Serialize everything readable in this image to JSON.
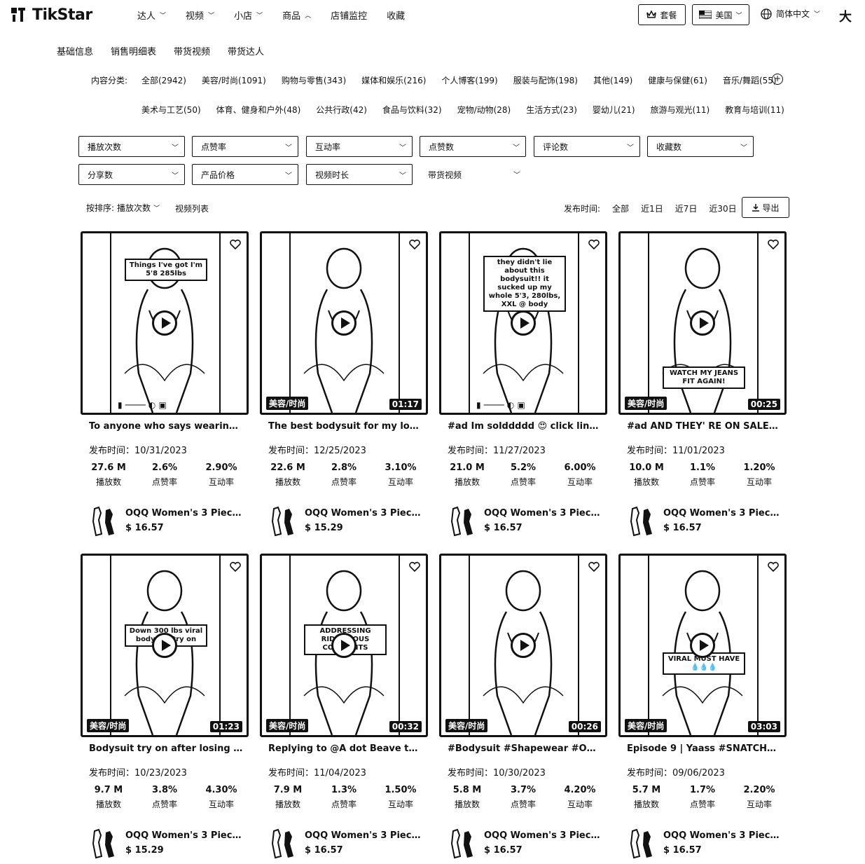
{
  "app": {
    "name": "TikStar"
  },
  "nav": {
    "items": [
      {
        "label": "达人",
        "chevron": "down"
      },
      {
        "label": "视频",
        "chevron": "down"
      },
      {
        "label": "小店",
        "chevron": "down"
      },
      {
        "label": "商品",
        "chevron": "up"
      },
      {
        "label": "店铺监控",
        "chevron": ""
      },
      {
        "label": "收藏",
        "chevron": ""
      }
    ],
    "plan_label": "套餐",
    "region_label": "美国",
    "lang_label": "简体中文",
    "big_label": "大"
  },
  "subtabs": [
    "基础信息",
    "销售明细表",
    "带货视频",
    "带货达人"
  ],
  "categories": {
    "label": "内容分类:",
    "row1": [
      "全部(2942)",
      "美容/时尚(1091)",
      "购物与零售(343)",
      "媒体和娱乐(216)",
      "个人博客(199)",
      "服装与配饰(198)",
      "其他(149)",
      "健康与保健(61)",
      "音乐/舞蹈(55)"
    ],
    "row2": [
      "美术与工艺(50)",
      "体育、健身和户外(48)",
      "公共行政(42)",
      "食品与饮料(32)",
      "宠物/动物(28)",
      "生活方式(23)",
      "婴幼儿(21)",
      "旅游与观光(11)",
      "教育与培训(11)"
    ]
  },
  "filters": {
    "row1": [
      "播放次数",
      "点赞率",
      "互动率",
      "点赞数",
      "评论数",
      "收藏数"
    ],
    "row2": [
      "分享数",
      "产品价格",
      "视频时长",
      "带货视频"
    ]
  },
  "sort": {
    "label": "按排序:",
    "value": "播放次数",
    "list_view": "视频列表"
  },
  "date_filter": {
    "label": "发布时间:",
    "options": [
      "全部",
      "近1日",
      "近7日",
      "近30日"
    ]
  },
  "export_label": "导出",
  "stat_labels": {
    "plays": "播放数",
    "like_rate": "点赞率",
    "engagement": "互动率",
    "date_prefix": "发布时间："
  },
  "videos": [
    {
      "title": "To anyone who says wearing ...",
      "date": "10/31/2023",
      "plays": "27.6 M",
      "like_rate": "2.6%",
      "engagement": "2.90%",
      "product": "OQQ Women's 3 Piece...",
      "price": "$ 16.57",
      "badge": "",
      "duration": "",
      "overlay": "Things I've got I'm 5'8 285lbs",
      "controls": true
    },
    {
      "title": "The best bodysuit for my loos...",
      "date": "12/25/2023",
      "plays": "22.6 M",
      "like_rate": "2.8%",
      "engagement": "3.10%",
      "product": "OQQ Women's 3 Piece...",
      "price": "$ 15.29",
      "badge": "美容/时尚",
      "duration": "01:17",
      "overlay": "",
      "controls": false
    },
    {
      "title": "#ad Im solddddd 😍 click link...",
      "date": "11/27/2023",
      "plays": "21.0 M",
      "like_rate": "5.2%",
      "engagement": "6.00%",
      "product": "OQQ Women's 3 Piece...",
      "price": "$ 16.57",
      "badge": "",
      "duration": "",
      "overlay": "they didn't lie about this bodysuit!! it sucked up my whole 5'3, 280lbs, XXL @ body",
      "controls": true
    },
    {
      "title": "#ad AND THEY' RE ON SALE ...",
      "date": "11/01/2023",
      "plays": "10.0 M",
      "like_rate": "1.1%",
      "engagement": "1.20%",
      "product": "OQQ Women's 3 Piece...",
      "price": "$ 16.57",
      "badge": "美容/时尚",
      "duration": "00:25",
      "overlay": "WATCH MY JEANS FIT AGAIN!",
      "controls": false
    },
    {
      "title": "Bodysuit try on after losing 3...",
      "date": "10/23/2023",
      "plays": "9.7 M",
      "like_rate": "3.8%",
      "engagement": "4.30%",
      "product": "OQQ Women's 3 Piece...",
      "price": "$ 15.29",
      "badge": "美容/时尚",
      "duration": "01:23",
      "overlay": "Down 300 lbs viral bodysuit try on",
      "controls": false
    },
    {
      "title": "Replying to @A dot Beave thi...",
      "date": "11/04/2023",
      "plays": "7.9 M",
      "like_rate": "1.3%",
      "engagement": "1.50%",
      "product": "OQQ Women's 3 Piece...",
      "price": "$ 16.57",
      "badge": "美容/时尚",
      "duration": "00:32",
      "overlay": "ADDRESSING RIDICULOUS COMMENTS",
      "controls": false
    },
    {
      "title": "#Bodysuit #Shapewear #OQQ...",
      "date": "10/30/2023",
      "plays": "5.8 M",
      "like_rate": "3.7%",
      "engagement": "4.20%",
      "product": "OQQ Women's 3 Piece...",
      "price": "$ 16.57",
      "badge": "美容/时尚",
      "duration": "00:26",
      "overlay": "",
      "controls": false
    },
    {
      "title": "Episode 9 | Yaass #SNATCHED...",
      "date": "09/06/2023",
      "plays": "5.7 M",
      "like_rate": "1.7%",
      "engagement": "2.20%",
      "product": "OQQ Women's 3 Piece...",
      "price": "$ 16.57",
      "badge": "美容/时尚",
      "duration": "03:03",
      "overlay": "VIRAL MUST HAVE💧💧💧",
      "controls": false
    }
  ]
}
